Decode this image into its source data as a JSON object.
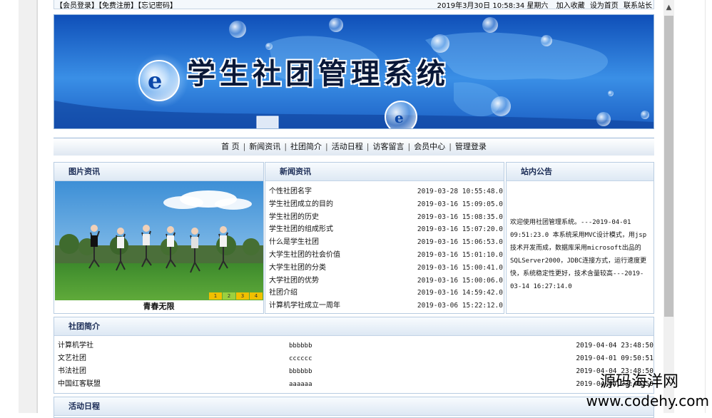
{
  "topbar": {
    "left_links": "【会员登录】【免费注册】【忘记密码】",
    "datetime": "2019年3月30日  10:58:34  星期六",
    "add_favorite": "加入收藏",
    "set_homepage": "设为首页",
    "contact": "联系站长"
  },
  "banner": {
    "title": "学生社团管理系统"
  },
  "nav": {
    "items": [
      "首 页",
      "新闻资讯",
      "社团简介",
      "活动日程",
      "访客留言",
      "会员中心",
      "管理登录"
    ]
  },
  "picture_panel": {
    "title": "图片资讯",
    "caption": "青春无限",
    "thumbs": [
      "1",
      "2",
      "3",
      "4"
    ]
  },
  "news_panel": {
    "title": "新闻资讯",
    "items": [
      {
        "title": "个性社团名字",
        "date": "2019-03-28 10:55:48.0"
      },
      {
        "title": "学生社团成立的目的",
        "date": "2019-03-16 15:09:05.0"
      },
      {
        "title": "学生社团的历史",
        "date": "2019-03-16 15:08:35.0"
      },
      {
        "title": "学生社团的组成形式",
        "date": "2019-03-16 15:07:20.0"
      },
      {
        "title": "什么是学生社团",
        "date": "2019-03-16 15:06:53.0"
      },
      {
        "title": "大学生社团的社会价值",
        "date": "2019-03-16 15:01:10.0"
      },
      {
        "title": "大学生社团的分类",
        "date": "2019-03-16 15:00:41.0"
      },
      {
        "title": "大学社团的优势",
        "date": "2019-03-16 15:00:06.0"
      },
      {
        "title": "社团介绍",
        "date": "2019-03-16 14:59:42.0"
      },
      {
        "title": "计算机学社成立一周年",
        "date": "2019-03-06 15:22:12.0"
      }
    ]
  },
  "notice_panel": {
    "title": "站内公告",
    "text": "欢迎使用社团管理系统。---2019-04-01 09:51:23.0 本系统采用MVC设计模式，用jsp技术开发而成，数据库采用microsoft出品的SQLServer2000，JDBC连接方式，运行速度更快，系统稳定性更好，技术含量较高---2019-03-14 16:27:14.0"
  },
  "clubs_panel": {
    "title": "社团简介",
    "items": [
      {
        "name": "计算机学社",
        "content": "bbbbbb",
        "date": "2019-04-04 23:48:50"
      },
      {
        "name": "文艺社团",
        "content": "cccccc",
        "date": "2019-04-01 09:50:51"
      },
      {
        "name": "书法社团",
        "content": "bbbbbb",
        "date": "2019-04-04 23:48:50"
      },
      {
        "name": "中国红客联盟",
        "content": "aaaaaa",
        "date": "2019-04-04 23:48:50"
      }
    ]
  },
  "activity_panel": {
    "title": "活动日程"
  },
  "watermark": {
    "line1": "源码海洋网",
    "line2": "www.codehy.com"
  },
  "colors": {
    "panel_border": "#b9cde2",
    "panel_title": "#1a2b55",
    "banner_blue": "#1a5fc8"
  }
}
